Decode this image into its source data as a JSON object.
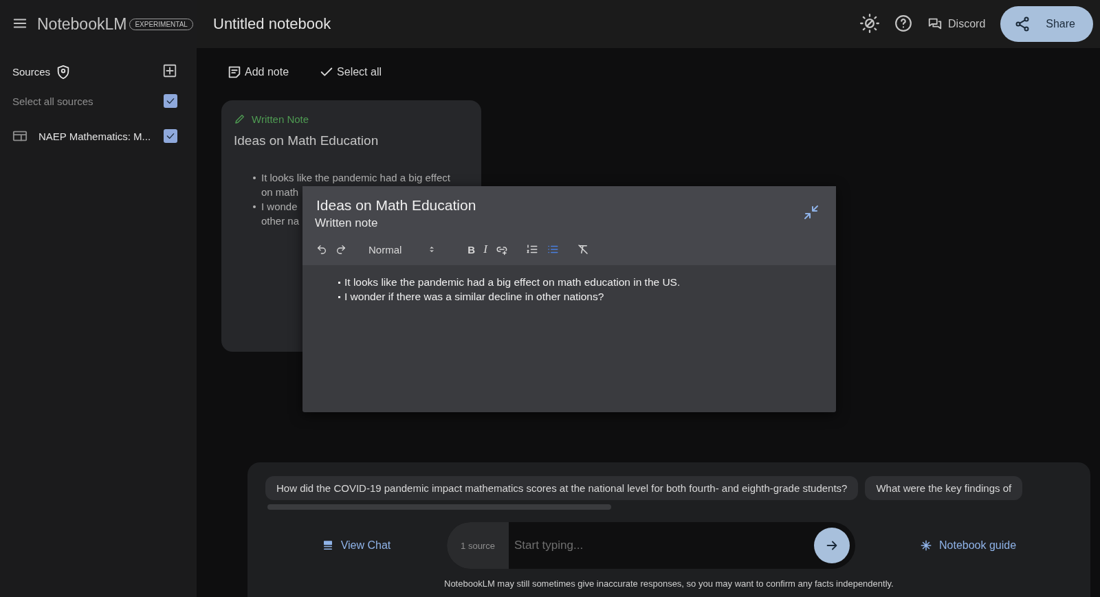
{
  "app": {
    "name": "NotebookLM",
    "badge": "EXPERIMENTAL"
  },
  "notebook": {
    "title": "Untitled notebook"
  },
  "header_actions": {
    "discord": "Discord",
    "share": "Share"
  },
  "sidebar": {
    "title": "Sources",
    "select_all": {
      "label": "Select all sources",
      "checked": true
    },
    "sources": [
      {
        "name": "NAEP Mathematics: M...",
        "checked": true
      }
    ]
  },
  "notes_toolbar": {
    "add_note": "Add note",
    "select_all": "Select all"
  },
  "note_card": {
    "kind_label": "Written Note",
    "title": "Ideas on Math Education",
    "bullets": [
      {
        "lines": [
          "It looks like the pandemic had a big effect",
          "on math"
        ]
      },
      {
        "lines": [
          "I wonde",
          "other na"
        ]
      }
    ]
  },
  "note_editor": {
    "title": "Ideas on Math Education",
    "subtitle": "Written note",
    "toolbar": [
      {
        "kind": "undo",
        "selected": false
      },
      {
        "kind": "redo",
        "selected": false
      },
      {
        "kind": "select",
        "label": "Normal",
        "selected": false
      },
      {
        "kind": "bold",
        "label": "B",
        "selected": false
      },
      {
        "kind": "italic",
        "label": "I",
        "selected": false
      },
      {
        "kind": "link",
        "selected": false
      },
      {
        "kind": "numbered",
        "selected": false
      },
      {
        "kind": "bulleted",
        "selected": true
      },
      {
        "kind": "clear",
        "selected": false
      }
    ],
    "bullets": [
      "It looks like the pandemic had a big effect on math education in the US.",
      "I wonder if there was a similar decline in other nations?"
    ]
  },
  "chat": {
    "suggestions": [
      "How did the COVID-19 pandemic impact mathematics scores at the national level for both fourth- and eighth-grade students?",
      "What were the key findings of"
    ],
    "view_chat": "View Chat",
    "source_count": "1 source",
    "input": {
      "placeholder": "Start typing..."
    },
    "notebook_guide": "Notebook guide",
    "disclaimer": "NotebookLM may still sometimes give inaccurate responses, so you may want to confirm any facts independently."
  }
}
